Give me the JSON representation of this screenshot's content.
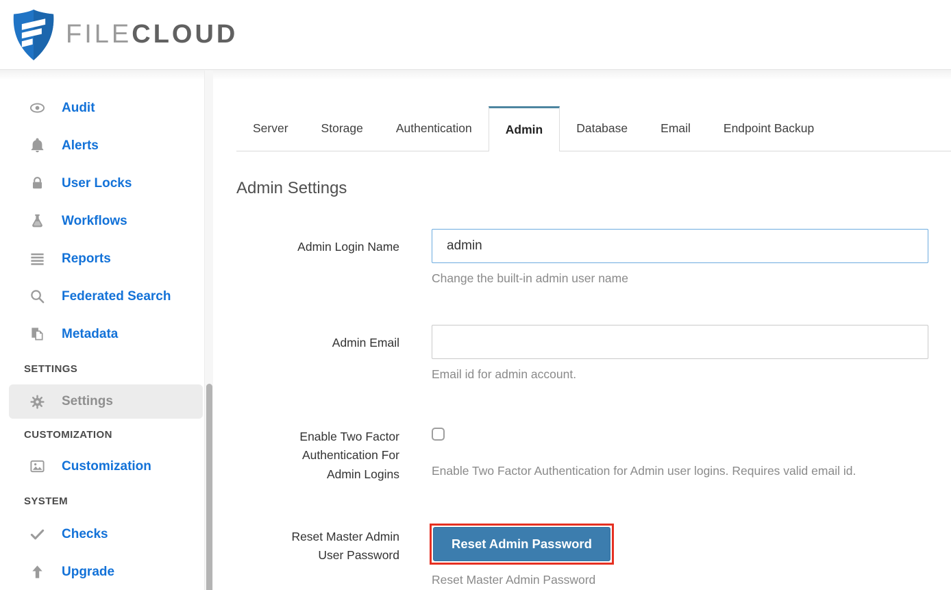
{
  "header": {
    "brand": {
      "file": "FILE",
      "cloud": "CLOUD"
    }
  },
  "colors": {
    "brand_blue": "#2074c5",
    "link_blue": "#1372d8",
    "tab_accent": "#4d85a0",
    "button_blue": "#3c7dae",
    "highlight_red": "#e53022",
    "focused_input_border": "#6cabdf"
  },
  "sidebar": {
    "items": [
      {
        "label": "Audit",
        "icon": "eye-icon"
      },
      {
        "label": "Alerts",
        "icon": "bell-icon"
      },
      {
        "label": "User Locks",
        "icon": "lock-icon"
      },
      {
        "label": "Workflows",
        "icon": "flask-icon"
      },
      {
        "label": "Reports",
        "icon": "list-icon"
      },
      {
        "label": "Federated Search",
        "icon": "search-icon"
      },
      {
        "label": "Metadata",
        "icon": "copy-icon"
      }
    ],
    "sections": {
      "settings": "SETTINGS",
      "customization": "CUSTOMIZATION",
      "system": "SYSTEM"
    },
    "settings_item": {
      "label": "Settings",
      "icon": "gear-icon",
      "active": true
    },
    "customization_item": {
      "label": "Customization",
      "icon": "image-icon"
    },
    "checks_item": {
      "label": "Checks",
      "icon": "check-icon"
    },
    "upgrade_item": {
      "label": "Upgrade",
      "icon": "arrow-up-icon"
    }
  },
  "tabs": {
    "items": [
      "Server",
      "Storage",
      "Authentication",
      "Admin",
      "Database",
      "Email",
      "Endpoint Backup"
    ],
    "active": "Admin"
  },
  "main": {
    "title": "Admin Settings",
    "admin_login": {
      "label": "Admin Login Name",
      "value": "admin",
      "help": "Change the built-in admin user name"
    },
    "admin_email": {
      "label": "Admin Email",
      "value": "",
      "help": "Email id for admin account."
    },
    "two_factor": {
      "label": "Enable Two Factor Authentication For Admin Logins",
      "checked": false,
      "help": "Enable Two Factor Authentication for Admin user logins. Requires valid email id."
    },
    "reset_password": {
      "label": "Reset Master Admin User Password",
      "button": "Reset Admin Password",
      "help": "Reset Master Admin Password"
    }
  }
}
